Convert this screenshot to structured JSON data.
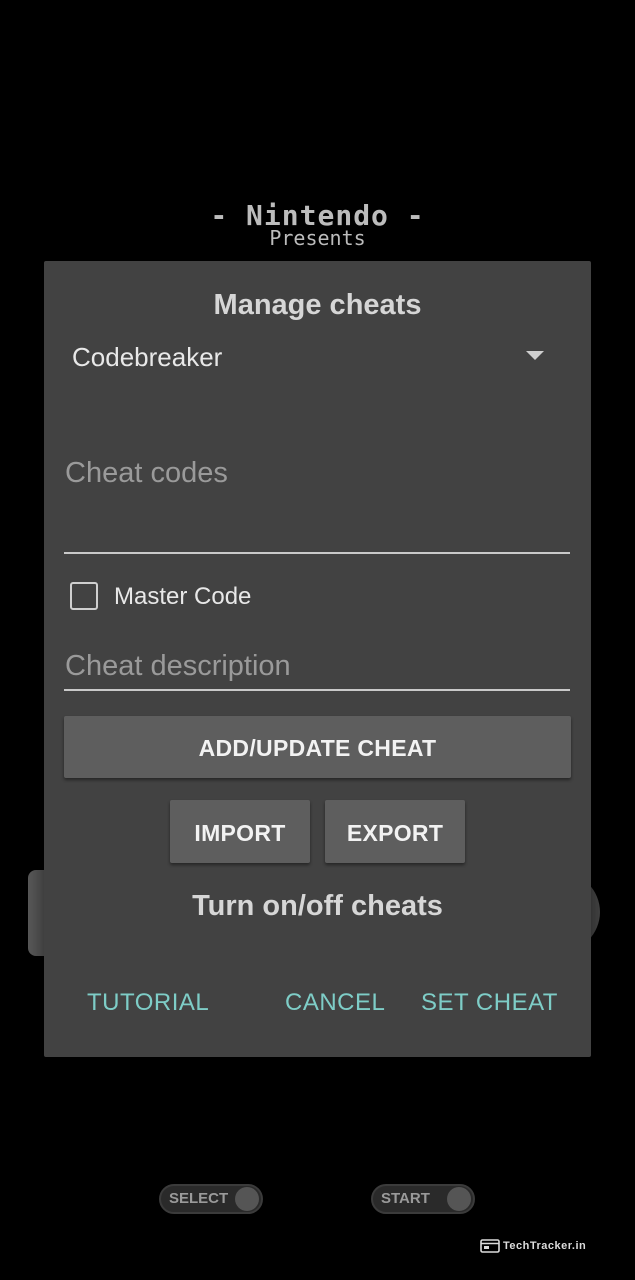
{
  "background": {
    "boot_logo_title": "- Nintendo -",
    "boot_logo_subtitle": "Presents",
    "select_label": "SELECT",
    "start_label": "START",
    "watermark": "TechTracker.in"
  },
  "dialog": {
    "title": "Manage cheats",
    "cheat_type": {
      "selected": "Codebreaker"
    },
    "cheat_codes": {
      "placeholder": "Cheat codes",
      "value": ""
    },
    "master_code": {
      "label": "Master Code",
      "checked": false
    },
    "cheat_description": {
      "placeholder": "Cheat description",
      "value": ""
    },
    "add_update_label": "ADD/UPDATE CHEAT",
    "import_label": "IMPORT",
    "export_label": "EXPORT",
    "toggle_section_label": "Turn on/off cheats",
    "actions": {
      "tutorial": "TUTORIAL",
      "cancel": "CANCEL",
      "set_cheat": "SET CHEAT"
    }
  },
  "colors": {
    "dialog_bg": "#424242",
    "button_bg": "#5e5e5e",
    "accent": "#7ecdc7"
  },
  "icons": {
    "spinner": "chevron-down-icon",
    "checkbox": "checkbox-unchecked-icon",
    "watermark": "browser-window-icon"
  }
}
